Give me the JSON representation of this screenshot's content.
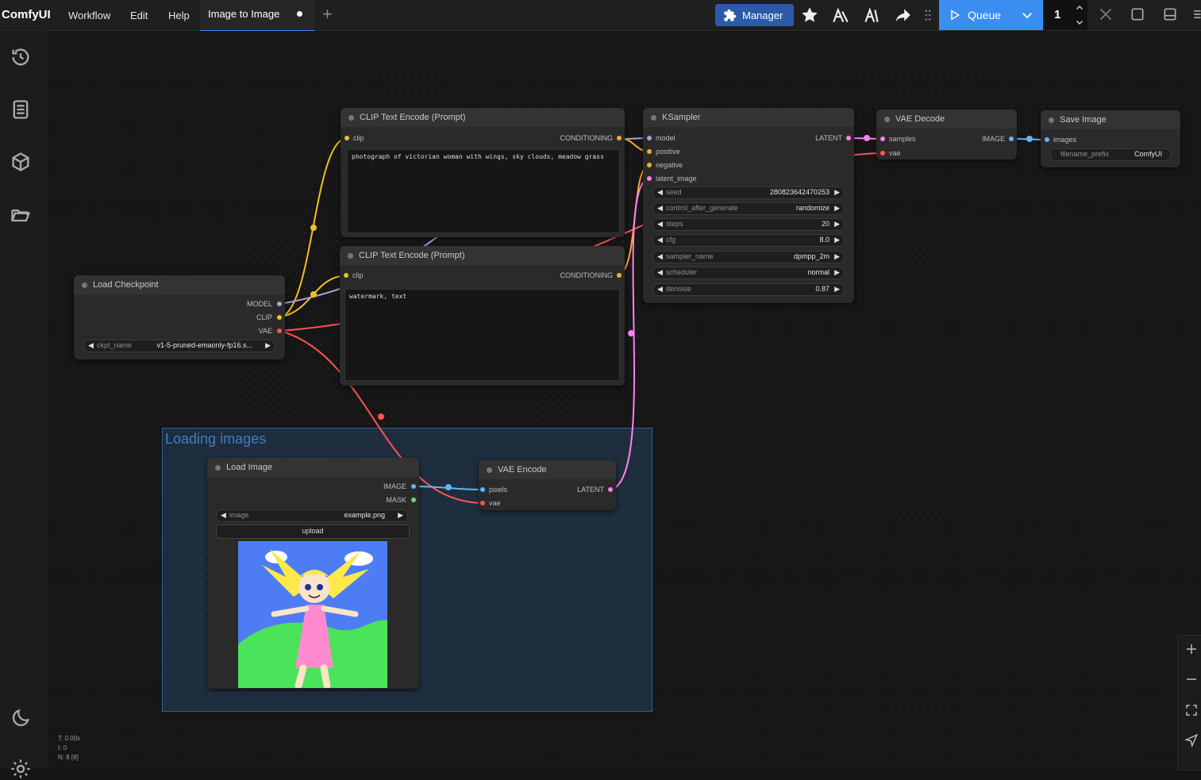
{
  "app": {
    "brand": "ComfyUI"
  },
  "menu": [
    "Workflow",
    "Edit",
    "Help"
  ],
  "tab": {
    "label": "Image to Image"
  },
  "toolbar": {
    "manager": "Manager",
    "queue": "Queue",
    "queue_count": "1"
  },
  "colors": {
    "accent": "#3b8ef0",
    "manager": "#2c5aa8",
    "clip": "#f0c020",
    "model": "#b39ddb",
    "vae": "#ff5252",
    "conditioning": "#ffa931",
    "latent": "#ff7ff0",
    "image": "#64b5f6",
    "mask": "#81c784"
  },
  "group": {
    "title": "Loading images"
  },
  "nodes": {
    "clip1": {
      "title": "CLIP Text Encode (Prompt)",
      "in": "clip",
      "out": "CONDITIONING",
      "text": "photograph of victorian woman with wings, sky clouds, meadow grass"
    },
    "clip2": {
      "title": "CLIP Text Encode (Prompt)",
      "in": "clip",
      "out": "CONDITIONING",
      "text": "watermark, text"
    },
    "ckpt": {
      "title": "Load Checkpoint",
      "outs": [
        "MODEL",
        "CLIP",
        "VAE"
      ],
      "widget_label": "ckpt_name",
      "widget_value": "v1-5-pruned-emaonly-fp16.s..."
    },
    "ksampler": {
      "title": "KSampler",
      "ins": [
        "model",
        "positive",
        "negative",
        "latent_image"
      ],
      "out": "LATENT",
      "widgets": [
        {
          "label": "seed",
          "value": "280823642470253"
        },
        {
          "label": "control_after_generate",
          "value": "randomize"
        },
        {
          "label": "steps",
          "value": "20"
        },
        {
          "label": "cfg",
          "value": "8.0"
        },
        {
          "label": "sampler_name",
          "value": "dpmpp_2m"
        },
        {
          "label": "scheduler",
          "value": "normal"
        },
        {
          "label": "denoise",
          "value": "0.87"
        }
      ]
    },
    "vaedecode": {
      "title": "VAE Decode",
      "ins": [
        "samples",
        "vae"
      ],
      "out": "IMAGE"
    },
    "save": {
      "title": "Save Image",
      "in": "images",
      "widget_label": "filename_prefix",
      "widget_value": "ComfyUI"
    },
    "loadimage": {
      "title": "Load Image",
      "outs": [
        "IMAGE",
        "MASK"
      ],
      "widget_label": "image",
      "widget_value": "example.png",
      "upload": "upload"
    },
    "vaeencode": {
      "title": "VAE Encode",
      "ins": [
        "pixels",
        "vae"
      ],
      "out": "LATENT"
    }
  },
  "stats": [
    "T: 0.00s",
    "I: 0",
    "N: 8 [8]"
  ]
}
